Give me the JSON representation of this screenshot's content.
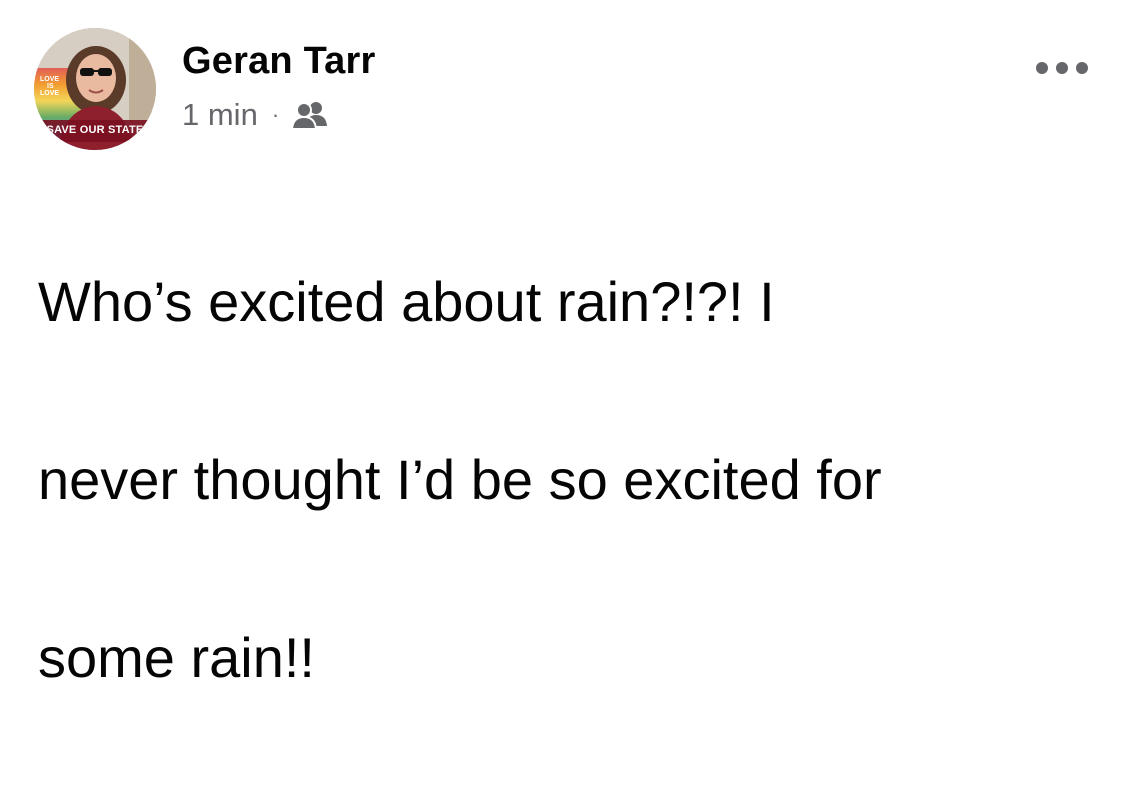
{
  "post": {
    "author": {
      "name": "Geran Tarr",
      "avatar_overlay": {
        "top_text_lines": [
          "LOVE",
          "IS",
          "LOVE"
        ],
        "bottom_text": "SAVE OUR STATE"
      }
    },
    "meta": {
      "timestamp": "1 min",
      "separator": "·",
      "audience_icon": "friends-icon"
    },
    "more_icon": "more-options-icon",
    "text_lines": [
      "Who’s excited about rain?!?! I",
      "never thought I’d be so excited for",
      "some rain!!"
    ]
  },
  "colors": {
    "text_primary": "#050505",
    "text_secondary": "#65676b",
    "background": "#ffffff"
  }
}
